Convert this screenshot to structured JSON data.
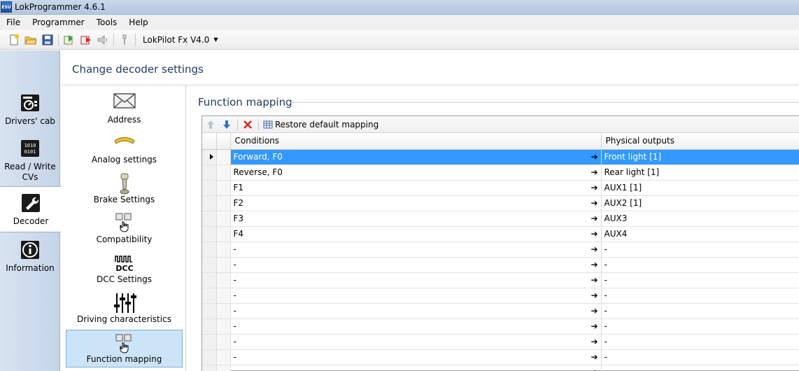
{
  "window": {
    "title": "LokProgrammer 4.6.1",
    "app_icon_text": "ESU"
  },
  "menu": [
    "File",
    "Programmer",
    "Tools",
    "Help"
  ],
  "toolbar": {
    "decoder_select": "LokPilot Fx V4.0"
  },
  "nav": {
    "items": [
      {
        "label": "Drivers' cab",
        "icon": "drivers-cab-icon"
      },
      {
        "label": "Read / Write CVs",
        "icon": "read-write-cvs-icon"
      },
      {
        "label": "Decoder",
        "icon": "wrench-icon",
        "active": true
      },
      {
        "label": "Information",
        "icon": "info-icon"
      }
    ]
  },
  "header": {
    "title": "Change decoder settings"
  },
  "categories": [
    {
      "label": "Address",
      "icon": "envelope-icon"
    },
    {
      "label": "Analog settings",
      "icon": "analog-icon"
    },
    {
      "label": "Brake Settings",
      "icon": "brake-icon"
    },
    {
      "label": "Compatibility",
      "icon": "compatibility-icon"
    },
    {
      "label": "DCC Settings",
      "icon": "dcc-icon",
      "icon_text": "DCC"
    },
    {
      "label": "Driving characteristics",
      "icon": "sliders-icon"
    },
    {
      "label": "Function mapping",
      "icon": "function-mapping-icon",
      "active": true
    }
  ],
  "section": {
    "title": "Function mapping"
  },
  "grid": {
    "toolbar": {
      "restore_label": "Restore default mapping"
    },
    "columns": {
      "conditions": "Conditions",
      "outputs": "Physical outputs"
    },
    "arrow": "➔",
    "rows": [
      {
        "condition": "Forward, F0",
        "output": "Front light [1]",
        "selected": true
      },
      {
        "condition": "Reverse, F0",
        "output": "Rear light [1]"
      },
      {
        "condition": "F1",
        "output": "AUX1 [1]"
      },
      {
        "condition": "F2",
        "output": "AUX2 [1]"
      },
      {
        "condition": "F3",
        "output": "AUX3"
      },
      {
        "condition": "F4",
        "output": "AUX4"
      },
      {
        "condition": "-",
        "output": "-"
      },
      {
        "condition": "-",
        "output": "-"
      },
      {
        "condition": "-",
        "output": "-"
      },
      {
        "condition": "-",
        "output": "-"
      },
      {
        "condition": "-",
        "output": "-"
      },
      {
        "condition": "-",
        "output": "-"
      },
      {
        "condition": "-",
        "output": "-"
      },
      {
        "condition": "-",
        "output": "-"
      },
      {
        "condition": "-",
        "output": "-"
      }
    ]
  },
  "colors": {
    "selection": "#3399ff",
    "active_category": "#cce4f7",
    "title_text": "#1e3a5f"
  }
}
